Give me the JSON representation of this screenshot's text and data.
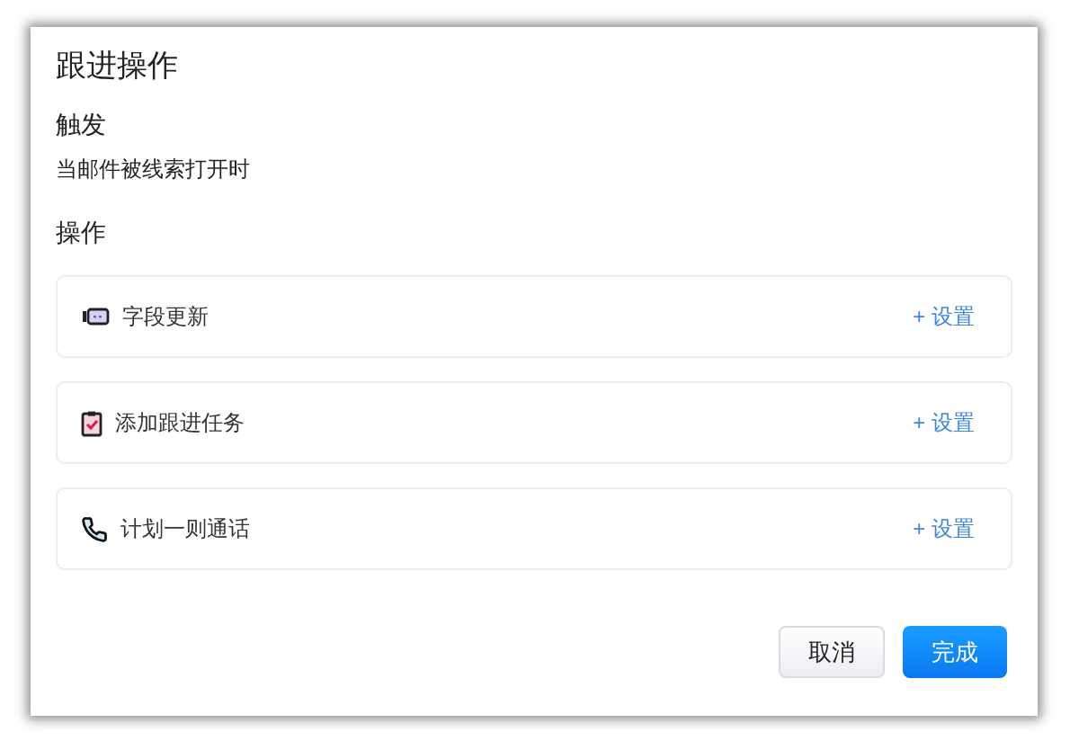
{
  "dialog": {
    "title": "跟进操作"
  },
  "trigger": {
    "heading": "触发",
    "description": "当邮件被线索打开时"
  },
  "actions_heading": "操作",
  "actions": [
    {
      "kind": "field",
      "label": "字段更新",
      "link": "+ 设置"
    },
    {
      "kind": "task",
      "label": "添加跟进任务",
      "link": "+ 设置"
    },
    {
      "kind": "call",
      "label": "计划一则通话",
      "link": "+ 设置"
    }
  ],
  "buttons": {
    "cancel": "取消",
    "confirm": "完成"
  }
}
